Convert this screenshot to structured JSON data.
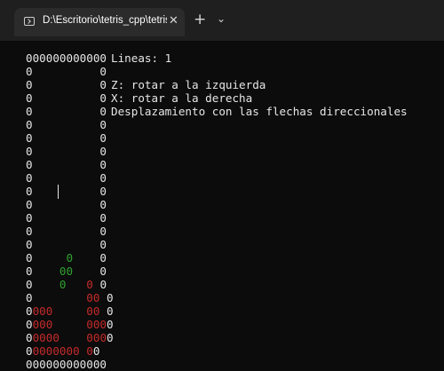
{
  "window": {
    "tab_title": "D:\\Escritorio\\tetris_cpp\\tetris_",
    "close_symbol": "✕",
    "new_tab_symbol": "+",
    "dropdown_symbol": "⌄",
    "icons": [
      "terminal-icon",
      "close-icon",
      "plus-icon",
      "chevron-down-icon"
    ]
  },
  "terminal": {
    "lines_label": "Lineas: 1",
    "help": [
      "Z: rotar a la izquierda",
      "X: rotar a la derecha",
      "Desplazamiento con las flechas direccionales"
    ],
    "board": [
      "000000000000",
      "0          0",
      "0          0",
      "0          0",
      "0          0",
      "0          0",
      "0          0",
      "0          0",
      "0          0",
      "0          0",
      "0          0",
      "0          0",
      "0          0",
      "0     0    0",
      "0    00    0",
      "0    0   0 0",
      "0        00 0",
      "0000     00 0",
      "0000     0000",
      "00000    0000",
      "00000000 00",
      "000000000000"
    ],
    "colors": {
      "text": "#e6e6e6",
      "locked_block": "#c52a2a",
      "falling_piece": "#2fa12f",
      "background": "#0c0c0c"
    }
  }
}
